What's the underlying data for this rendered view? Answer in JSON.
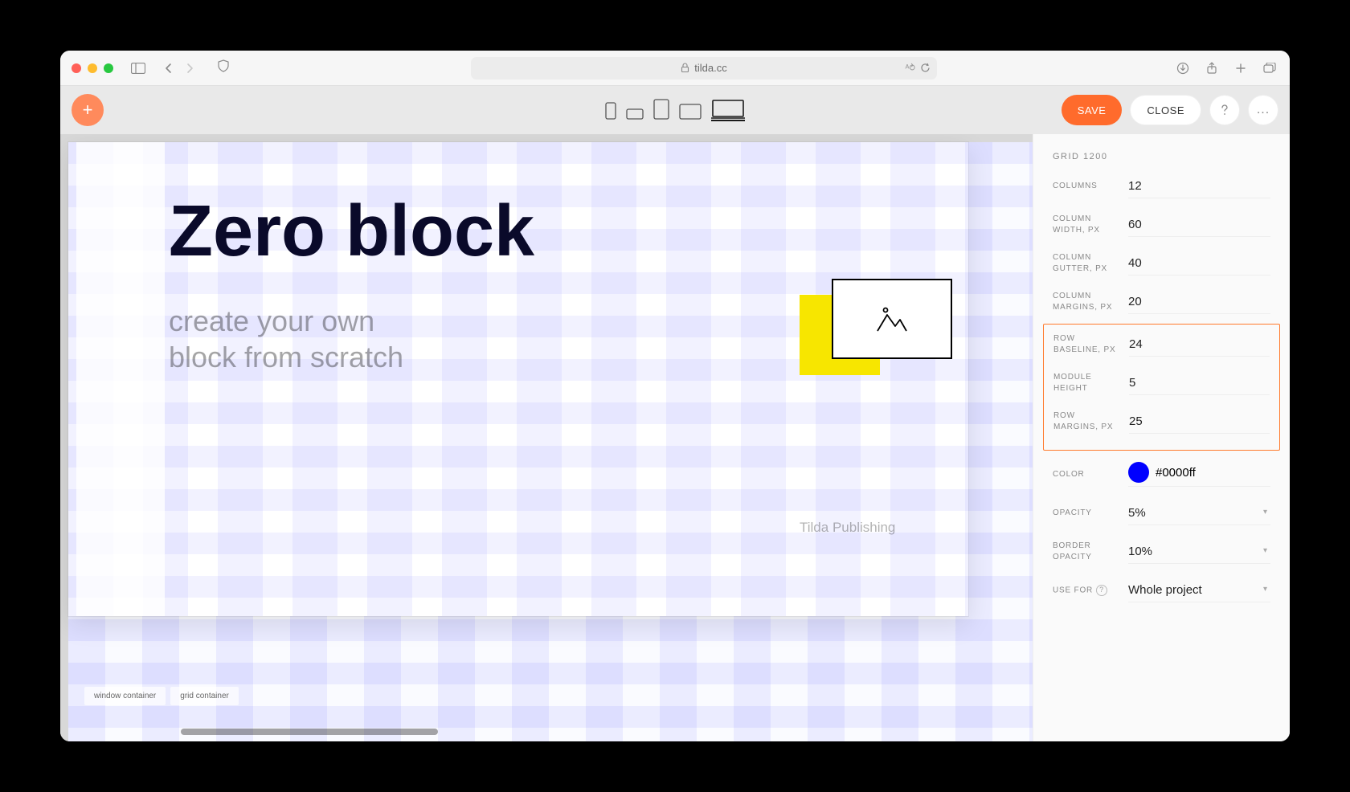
{
  "browser": {
    "url": "tilda.cc"
  },
  "toolbar": {
    "save_label": "SAVE",
    "close_label": "CLOSE"
  },
  "canvas": {
    "hero_title": "Zero block",
    "hero_sub_line1": "create your own",
    "hero_sub_line2": "block from scratch",
    "watermark": "Tilda Publishing",
    "label_window": "window container",
    "label_grid": "grid container"
  },
  "sidebar": {
    "title": "GRID 1200",
    "columns_label": "COLUMNS",
    "columns_val": "12",
    "col_width_label": "COLUMN WIDTH, PX",
    "col_width_val": "60",
    "col_gutter_label": "COLUMN GUTTER, PX",
    "col_gutter_val": "40",
    "col_margins_label": "COLUMN MARGINS, PX",
    "col_margins_val": "20",
    "row_baseline_label": "ROW BASELINE, PX",
    "row_baseline_val": "24",
    "module_height_label": "MODULE HEIGHT",
    "module_height_val": "5",
    "row_margins_label": "ROW MARGINS, PX",
    "row_margins_val": "25",
    "color_label": "COLOR",
    "color_val": "#0000ff",
    "opacity_label": "OPACITY",
    "opacity_val": "5%",
    "border_opacity_label": "BORDER OPACITY",
    "border_opacity_val": "10%",
    "use_for_label": "USE FOR",
    "use_for_val": "Whole project"
  }
}
